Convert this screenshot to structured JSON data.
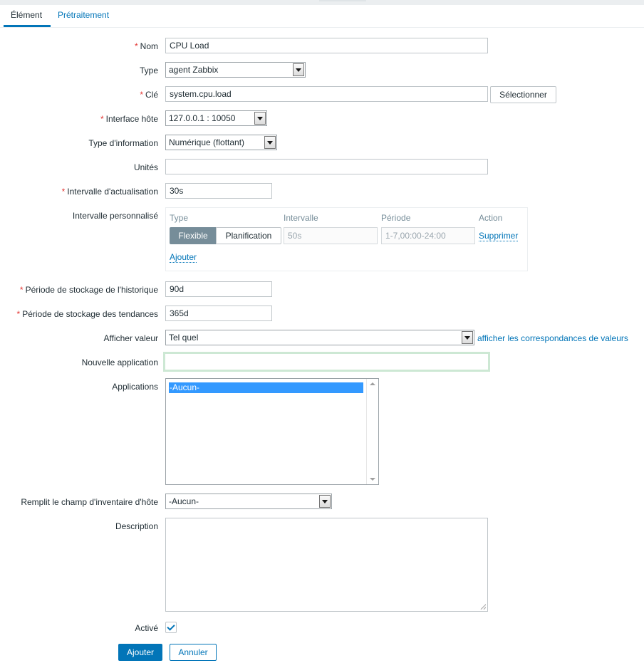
{
  "tabs": [
    "Élément",
    "Prétraitement"
  ],
  "form": {
    "name": {
      "label": "Nom",
      "value": "CPU Load"
    },
    "type": {
      "label": "Type",
      "value": "agent Zabbix"
    },
    "key": {
      "label": "Clé",
      "value": "system.cpu.load",
      "select_button": "Sélectionner"
    },
    "host_interface": {
      "label": "Interface hôte",
      "value": "127.0.0.1 : 10050"
    },
    "info_type": {
      "label": "Type d'information",
      "value": "Numérique (flottant)"
    },
    "units": {
      "label": "Unités",
      "value": ""
    },
    "update_interval": {
      "label": "Intervalle d'actualisation",
      "value": "30s"
    },
    "custom_intervals": {
      "label": "Intervalle personnalisé",
      "headers": {
        "type": "Type",
        "interval": "Intervalle",
        "period": "Période",
        "action": "Action"
      },
      "row": {
        "flexible": "Flexible",
        "scheduling": "Planification",
        "interval": "50s",
        "period": "1-7,00:00-24:00",
        "remove": "Supprimer"
      },
      "add": "Ajouter"
    },
    "history": {
      "label": "Période de stockage de l'historique",
      "value": "90d"
    },
    "trends": {
      "label": "Période de stockage des tendances",
      "value": "365d"
    },
    "show_value": {
      "label": "Afficher valeur",
      "value": "Tel quel",
      "link": "afficher les correspondances de valeurs"
    },
    "new_application": {
      "label": "Nouvelle application",
      "value": ""
    },
    "applications": {
      "label": "Applications",
      "items": [
        "-Aucun-"
      ]
    },
    "inventory": {
      "label": "Remplit le champ d'inventaire d'hôte",
      "value": "-Aucun-"
    },
    "description": {
      "label": "Description",
      "value": ""
    },
    "enabled": {
      "label": "Activé",
      "checked": true
    },
    "buttons": {
      "add": "Ajouter",
      "cancel": "Annuler"
    }
  },
  "colors": {
    "accent": "#0275b8",
    "required": "#e33734",
    "focus": "#cde8d4"
  }
}
